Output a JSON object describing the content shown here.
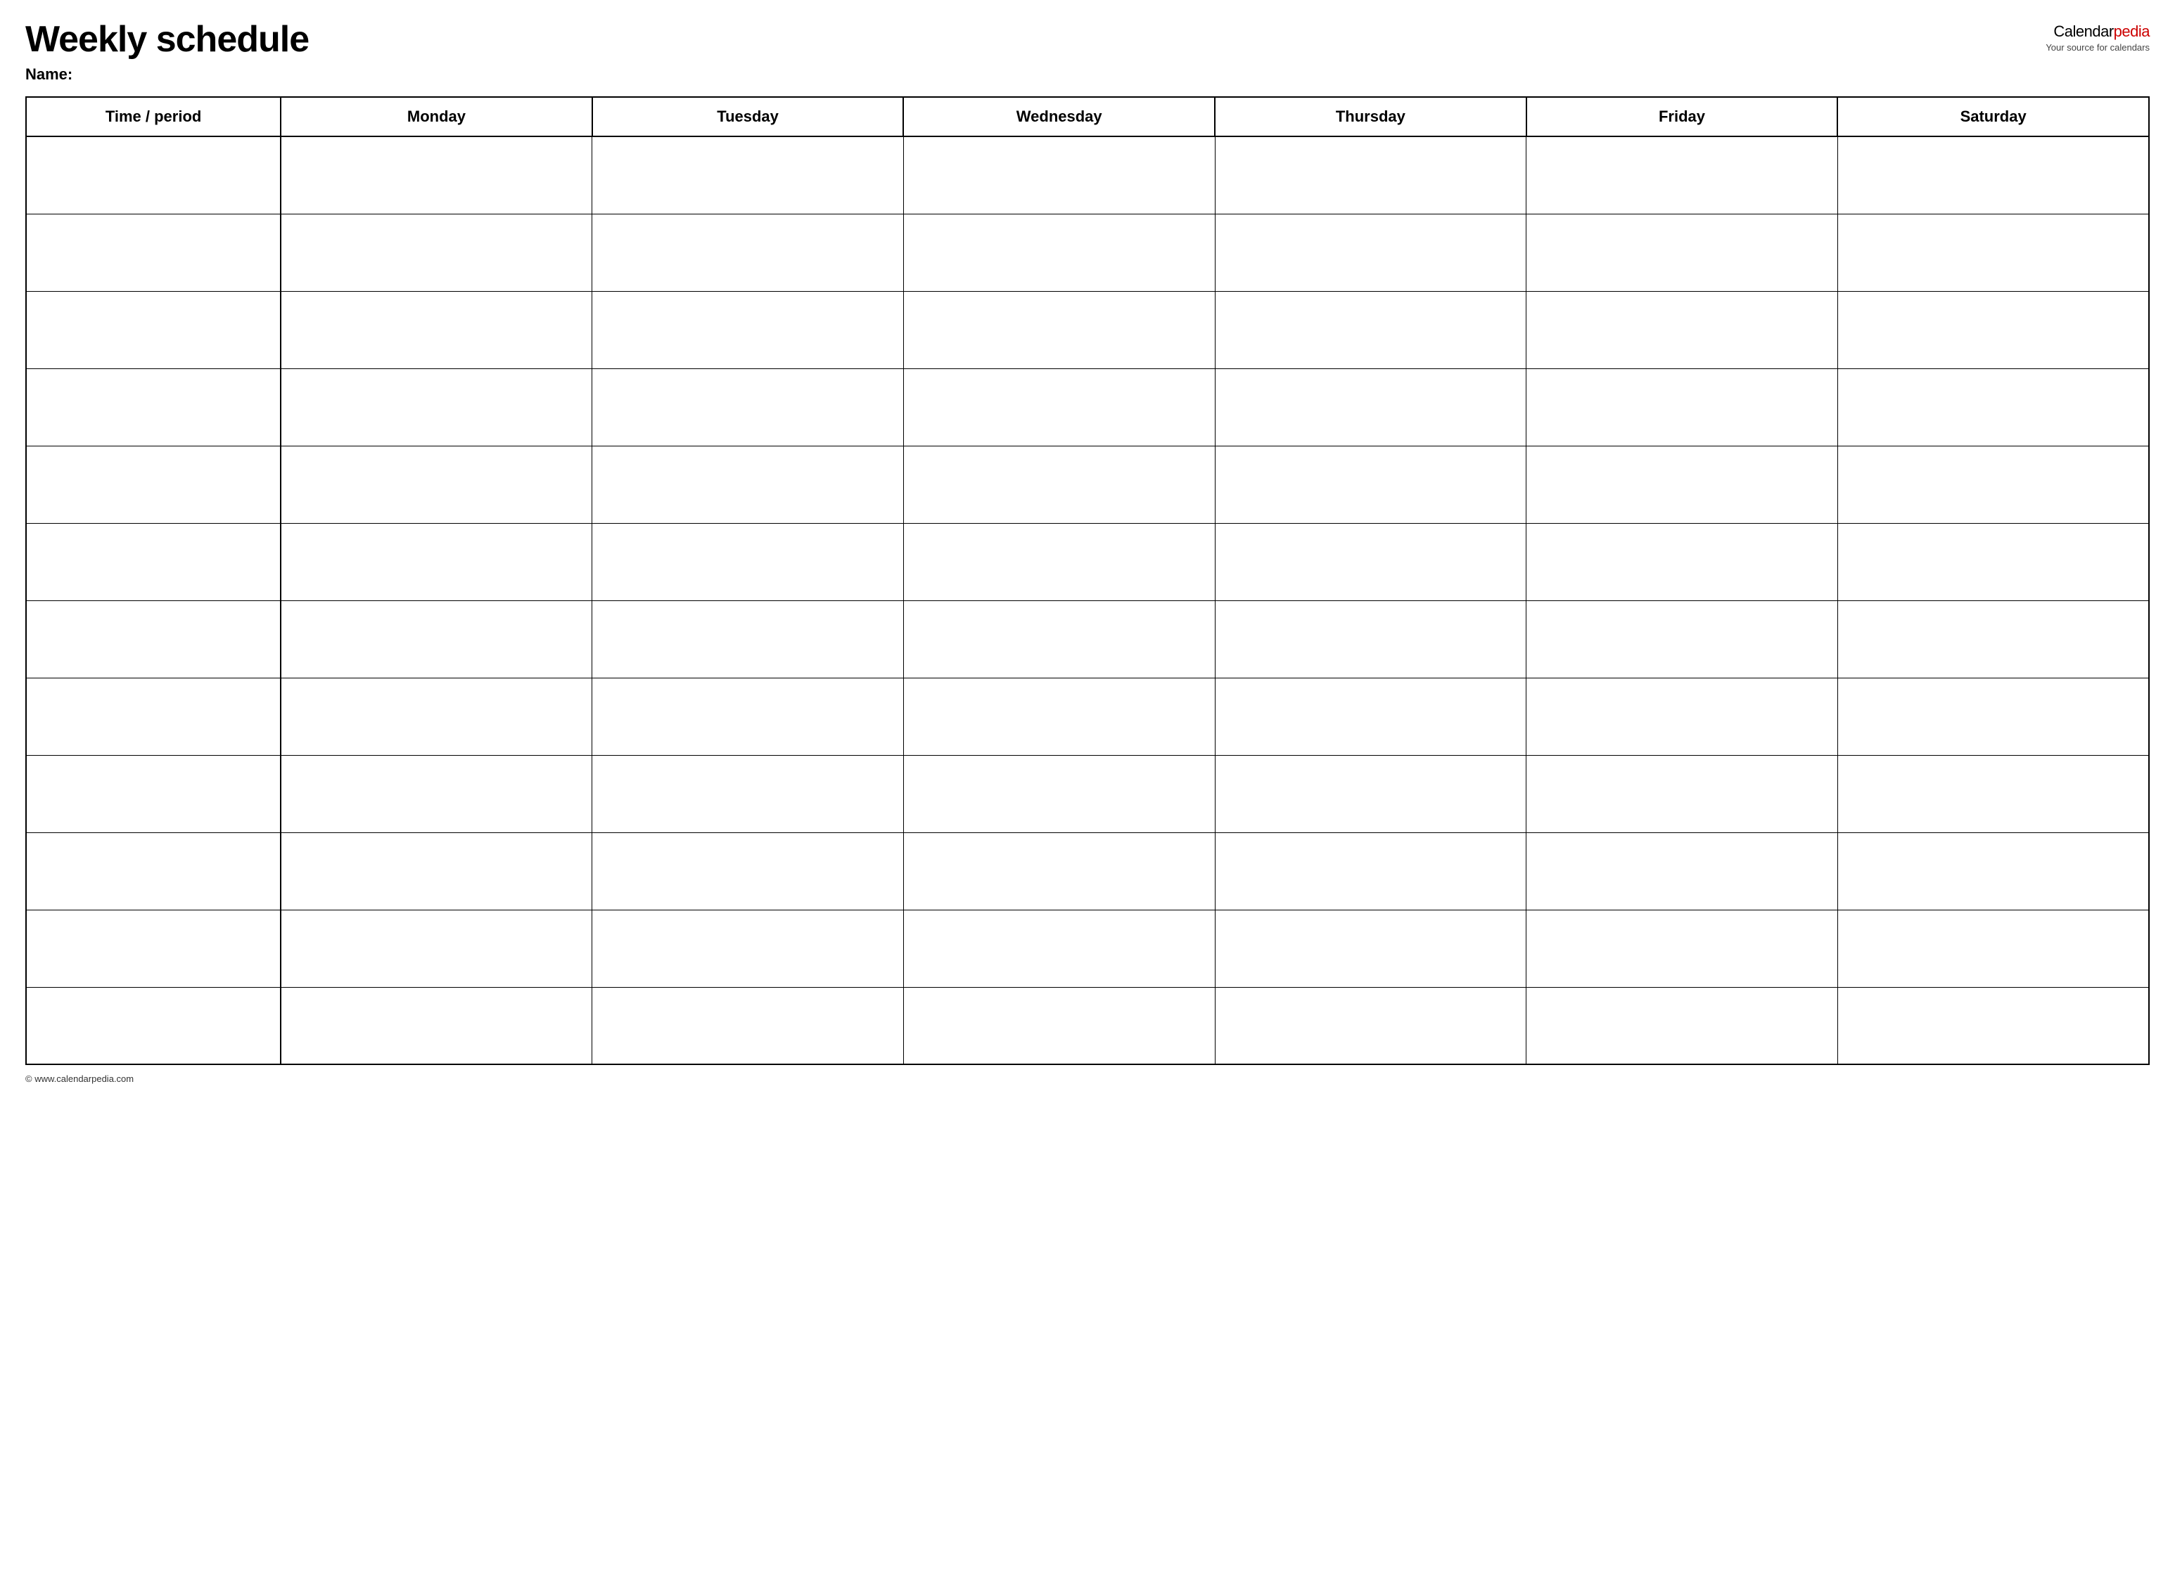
{
  "header": {
    "title": "Weekly schedule",
    "name_label": "Name:",
    "logo_text_black": "Calendar",
    "logo_text_red": "pedia",
    "logo_sub": "Your source for calendars"
  },
  "table": {
    "columns": [
      {
        "id": "time",
        "label": "Time / period"
      },
      {
        "id": "monday",
        "label": "Monday"
      },
      {
        "id": "tuesday",
        "label": "Tuesday"
      },
      {
        "id": "wednesday",
        "label": "Wednesday"
      },
      {
        "id": "thursday",
        "label": "Thursday"
      },
      {
        "id": "friday",
        "label": "Friday"
      },
      {
        "id": "saturday",
        "label": "Saturday"
      }
    ],
    "row_count": 12
  },
  "footer": {
    "copyright": "© www.calendarpedia.com"
  }
}
